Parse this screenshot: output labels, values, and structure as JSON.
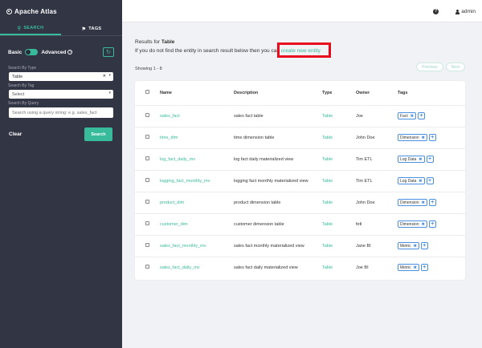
{
  "app": {
    "title": "Apache Atlas"
  },
  "sidebar": {
    "tabs": [
      {
        "label": "SEARCH",
        "icon": "search-icon",
        "active": true
      },
      {
        "label": "TAGS",
        "icon": "tag-icon",
        "active": false
      }
    ],
    "mode": {
      "basic_label": "Basic",
      "advanced_label": "Advanced"
    },
    "search_by_type": {
      "label": "Search By Type",
      "value": "Table"
    },
    "search_by_tag": {
      "label": "Search By Tag",
      "placeholder": "Select"
    },
    "search_by_query": {
      "label": "Search By Query",
      "placeholder": "Search using a query string: e.g. sales_fact"
    },
    "clear_label": "Clear",
    "search_label": "Search"
  },
  "topbar": {
    "user": "admin"
  },
  "main": {
    "results_prefix": "Results for",
    "results_type": "Table",
    "notfound_text": "If you do not find the entity in search result below then you can",
    "create_link": "create new entity",
    "showing": "Showing 1 - 8",
    "pager": {
      "previous": "Previous",
      "next": "Next"
    },
    "columns": {
      "name": "Name",
      "description": "Description",
      "type": "Type",
      "owner": "Owner",
      "tags": "Tags"
    },
    "rows": [
      {
        "name": "sales_fact",
        "description": "sales fact table",
        "type": "Table",
        "owner": "Joe",
        "tag": "Fact"
      },
      {
        "name": "time_dim",
        "description": "time dimension table",
        "type": "Table",
        "owner": "John Doe",
        "tag": "Dimension"
      },
      {
        "name": "log_fact_daily_mv",
        "description": "log fact daily materialized view",
        "type": "Table",
        "owner": "Tim ETL",
        "tag": "Log Data"
      },
      {
        "name": "logging_fact_monthly_mv",
        "description": "logging fact monthly materialized view",
        "type": "Table",
        "owner": "Tim ETL",
        "tag": "Log Data"
      },
      {
        "name": "product_dim",
        "description": "product dimension table",
        "type": "Table",
        "owner": "John Doe",
        "tag": "Dimension"
      },
      {
        "name": "customer_dim",
        "description": "customer dimension table",
        "type": "Table",
        "owner": "fetl",
        "tag": "Dimension"
      },
      {
        "name": "sales_fact_monthly_mv",
        "description": "sales fact monthly materialized view",
        "type": "Table",
        "owner": "Jane BI",
        "tag": "Metric"
      },
      {
        "name": "sales_fact_daily_mv",
        "description": "sales fact daily materialized view",
        "type": "Table",
        "owner": "Joe BI",
        "tag": "Metric"
      }
    ]
  },
  "colors": {
    "accent": "#38bb9b",
    "sidebar_bg": "#323544",
    "highlight": "#e8091c",
    "tag_border": "#4a90e2"
  }
}
